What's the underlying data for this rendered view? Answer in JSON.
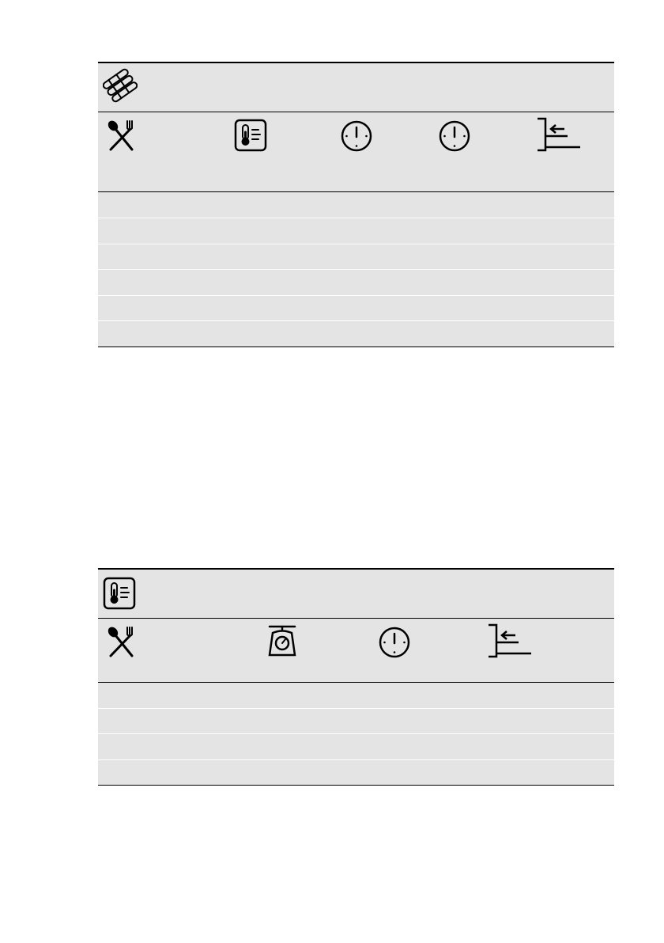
{
  "icons": {
    "table1_category": "sausages-icon",
    "table1_columns": [
      "cutlery-icon",
      "food-thermometer-icon",
      "clock-icon",
      "clock-icon",
      "shelf-position-icon"
    ],
    "table2_category": "food-thermometer-icon",
    "table2_columns": [
      "cutlery-icon",
      "kitchen-scale-icon",
      "clock-icon",
      "shelf-position-icon"
    ]
  },
  "table1": {
    "row_count": 6
  },
  "table2": {
    "row_count": 4
  },
  "colors": {
    "header_fill": "#e4e4e4",
    "rule": "#000000",
    "row_separator": "#ffffff"
  }
}
